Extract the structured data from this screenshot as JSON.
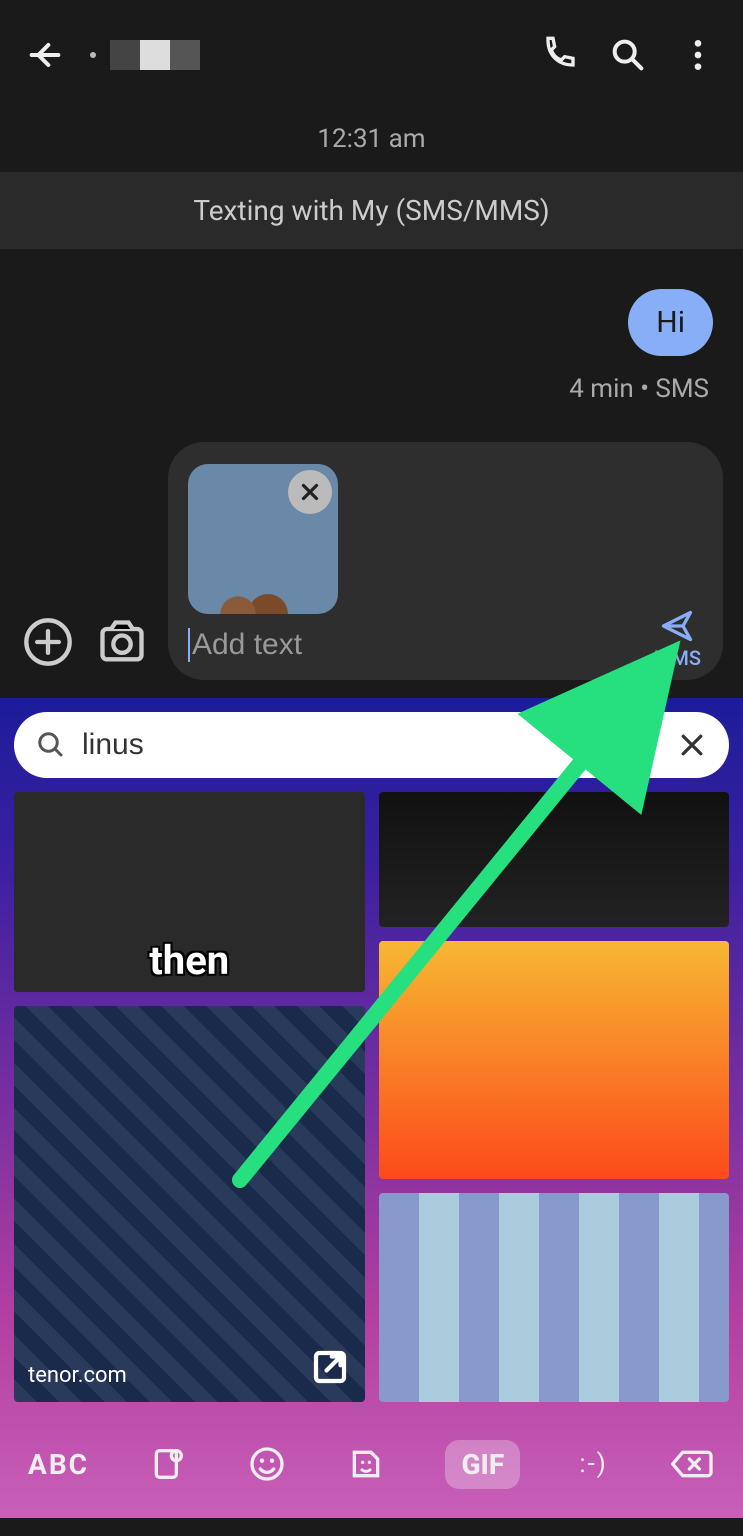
{
  "header": {
    "timestamp": "12:31 am",
    "status_banner": "Texting with My (SMS/MMS)"
  },
  "messages": {
    "outgoing": {
      "text": "Hi"
    },
    "meta": "4 min • SMS"
  },
  "compose": {
    "placeholder": "Add text",
    "send_label": "MMS"
  },
  "gif": {
    "search_value": "linus",
    "provider": "tenor.com",
    "tile_overlay_text": "then"
  },
  "keyboard": {
    "abc": "ABC",
    "gif": "GIF",
    "emoticon": ":-)"
  }
}
